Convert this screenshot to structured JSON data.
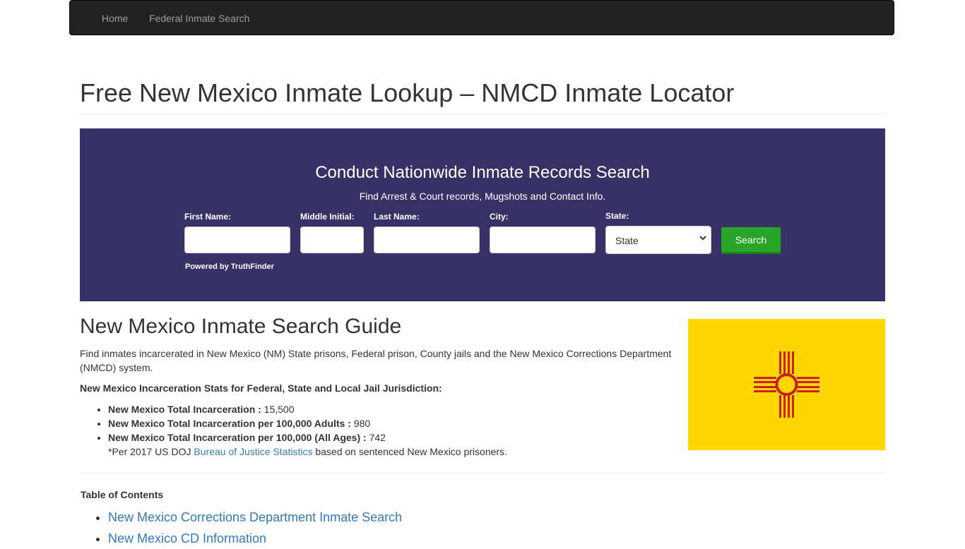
{
  "nav": {
    "home": "Home",
    "federal": "Federal Inmate Search"
  },
  "page": {
    "title": "Free New Mexico Inmate Lookup – NMCD Inmate Locator"
  },
  "search": {
    "heading": "Conduct Nationwide Inmate Records Search",
    "subheading": "Find Arrest & Court records, Mugshots and Contact Info.",
    "first_name_label": "First Name:",
    "middle_initial_label": "Middle Initial:",
    "last_name_label": "Last Name:",
    "city_label": "City:",
    "state_label": "State:",
    "state_value": "State",
    "button_label": "Search",
    "powered_by": "Powered by TruthFinder"
  },
  "guide": {
    "title": "New Mexico Inmate Search Guide",
    "intro": "Find inmates incarcerated in New Mexico (NM) State prisons, Federal prison, County jails and the New Mexico Corrections Department (NMCD) system.",
    "stats_heading": "New Mexico Incarceration Stats for Federal, State and Local Jail Jurisdiction:",
    "stats": [
      {
        "label": "New Mexico Total Incarceration  :",
        "value": " 15,500"
      },
      {
        "label": "New Mexico Total Incarceration per 100,000 Adults :",
        "value": " 980"
      },
      {
        "label": "New Mexico Total Incarceration per 100,000 (All Ages) :",
        "value": " 742"
      }
    ],
    "note_prefix": "*Per 2017 US DOJ ",
    "note_link": "Bureau of Justice Statistics",
    "note_suffix": " based on sentenced New Mexico prisoners."
  },
  "toc": {
    "heading": "Table of Contents",
    "items": [
      "New Mexico Corrections Department Inmate Search",
      "New Mexico CD Information"
    ]
  },
  "colors": {
    "search_bg": "#373166",
    "button": "#28a428",
    "flag_yellow": "#ffd700",
    "flag_red": "#cc1f1f",
    "link": "#337ab7"
  }
}
